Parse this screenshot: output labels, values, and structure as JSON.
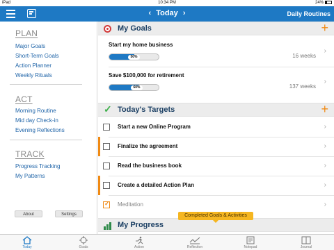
{
  "status_bar": {
    "device": "iPad",
    "time": "10:34 PM",
    "battery": "24%"
  },
  "nav": {
    "title": "Today",
    "prev": "‹",
    "next": "›",
    "right_label": "Daily Routines"
  },
  "sidebar": {
    "plan": {
      "title": "PLAN",
      "items": [
        "Major Goals",
        "Short-Term Goals",
        "Action Planner",
        "Weekly Rituals"
      ]
    },
    "act": {
      "title": "ACT",
      "items": [
        "Morning Routine",
        "Mid day Check-in",
        "Evening Reflections"
      ]
    },
    "track": {
      "title": "TRACK",
      "items": [
        "Progress Tracking",
        "My Patterns"
      ]
    },
    "about_label": "About",
    "settings_label": "Settings"
  },
  "goals": {
    "header": "My Goals",
    "items": [
      {
        "title": "Start my home business",
        "percent_label": "50%",
        "progress": 0.5,
        "weeks": "16 weeks"
      },
      {
        "title": "Save $100,000 for retirement",
        "percent_label": "60%",
        "progress": 0.6,
        "weeks": "137 weeks"
      }
    ]
  },
  "targets": {
    "header": "Today's Targets",
    "items": [
      {
        "title": "Start a new Online Program",
        "checked": false,
        "flagged": false
      },
      {
        "title": "Finalize the agreement",
        "checked": false,
        "flagged": true
      },
      {
        "title": "Read the business book",
        "checked": false,
        "flagged": false
      },
      {
        "title": "Create a detailed Action Plan",
        "checked": false,
        "flagged": true
      },
      {
        "title": "Meditation",
        "checked": true,
        "flagged": false
      }
    ]
  },
  "progress": {
    "header": "My Progress"
  },
  "tooltip": "Completed Goals & Activities",
  "tabs": [
    "Today",
    "Goals",
    "Action",
    "Reflection",
    "Notepad",
    "Journal"
  ],
  "colors": {
    "accent": "#1e79c4",
    "orange": "#f08a14",
    "green": "#3cae49",
    "red": "#d23a3a"
  },
  "icons": {
    "menu": "hamburger-icon",
    "calendar": "calendar-icon",
    "plus": "plus-icon",
    "target": "target-icon",
    "check": "checkmark-icon",
    "progress": "bar-chart-icon",
    "chevron": "chevron-right-icon"
  }
}
